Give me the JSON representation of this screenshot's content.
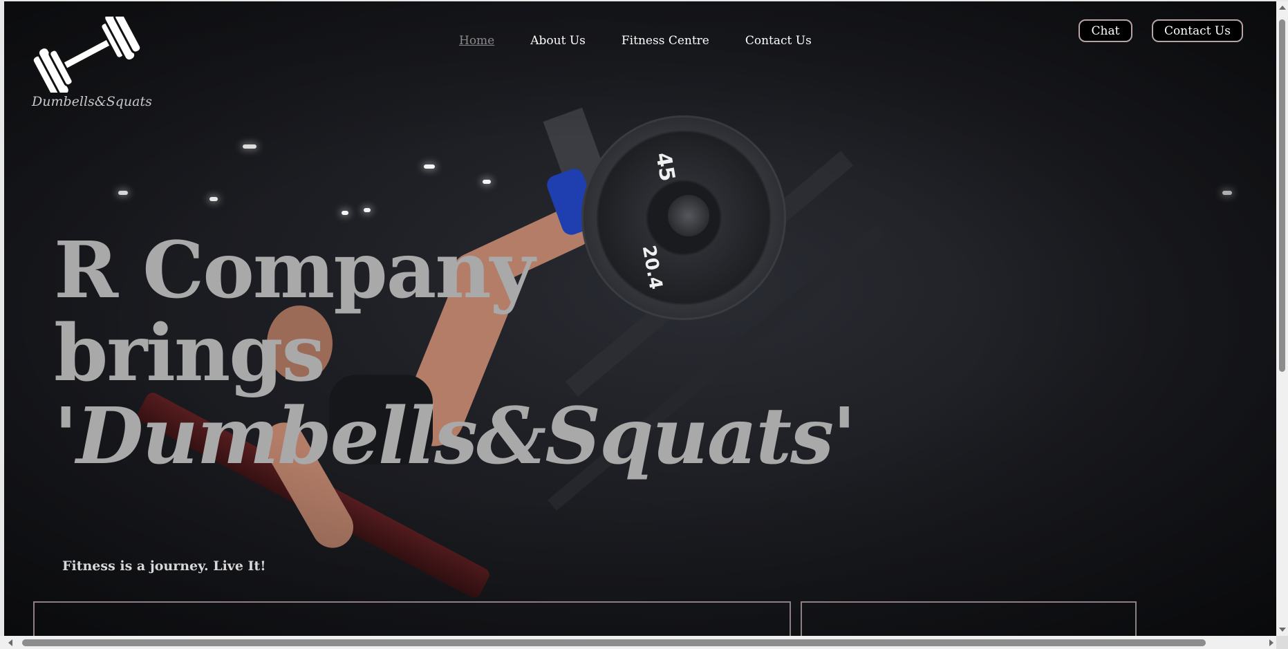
{
  "brand": {
    "logo_icon": "dumbbell-icon",
    "name": "Dumbells&Squats"
  },
  "nav": {
    "items": [
      {
        "label": "Home",
        "active": true
      },
      {
        "label": "About Us",
        "active": false
      },
      {
        "label": "Fitness Centre",
        "active": false
      },
      {
        "label": "Contact Us",
        "active": false
      }
    ]
  },
  "header_buttons": {
    "chat_label": "Chat",
    "contact_label": "Contact Us"
  },
  "hero": {
    "title_line1": "R Company",
    "title_line2": "brings",
    "title_line3": "'Dumbells&Squats'",
    "tagline": "Fitness is a journey. Live It!"
  },
  "background_image": {
    "plate_number_1": "45",
    "plate_number_2": "20.4"
  },
  "colors": {
    "page_background": "#1c1d22",
    "title_text": "#a9a9a9",
    "nav_active": "#8a8a8a",
    "nav_text": "#ffffff",
    "button_border": "#b8a3a7",
    "card_border": "#8e7f82"
  }
}
